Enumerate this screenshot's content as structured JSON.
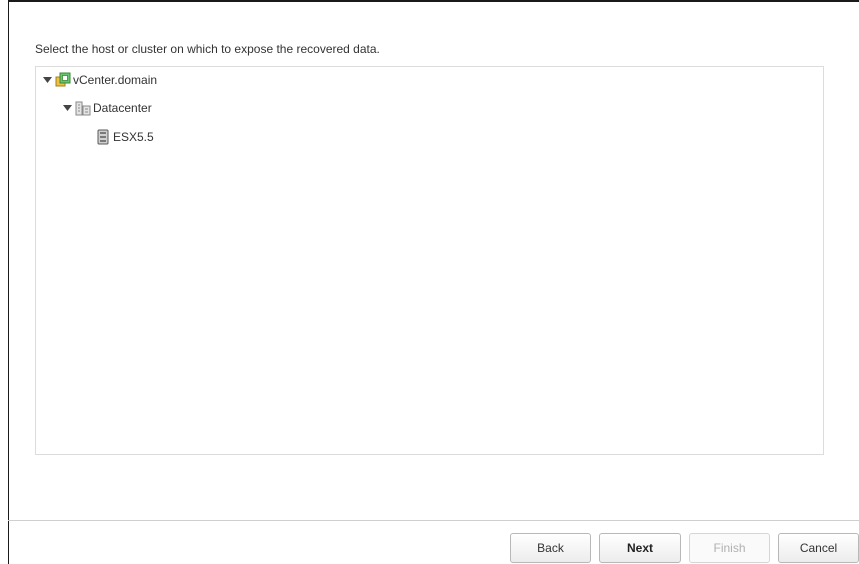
{
  "dialog": {
    "instruction": "Select the host or cluster on which to expose the recovered data."
  },
  "tree": {
    "nodes": [
      {
        "label": "vCenter.domain",
        "icon": "vcenter-icon",
        "expanded": true,
        "level": 0
      },
      {
        "label": "Datacenter",
        "icon": "datacenter-icon",
        "expanded": true,
        "level": 1
      },
      {
        "label": "ESX5.5",
        "icon": "host-server-icon",
        "expanded": null,
        "level": 2
      }
    ]
  },
  "footer": {
    "back_label": "Back",
    "next_label": "Next",
    "finish_label": "Finish",
    "cancel_label": "Cancel"
  },
  "colors": {
    "text": "#333333",
    "border": "#dcdcdc",
    "disabled_text": "#b0b0b0",
    "vcenter_green": "#5cb85c",
    "vcenter_yellow": "#f0c040"
  }
}
